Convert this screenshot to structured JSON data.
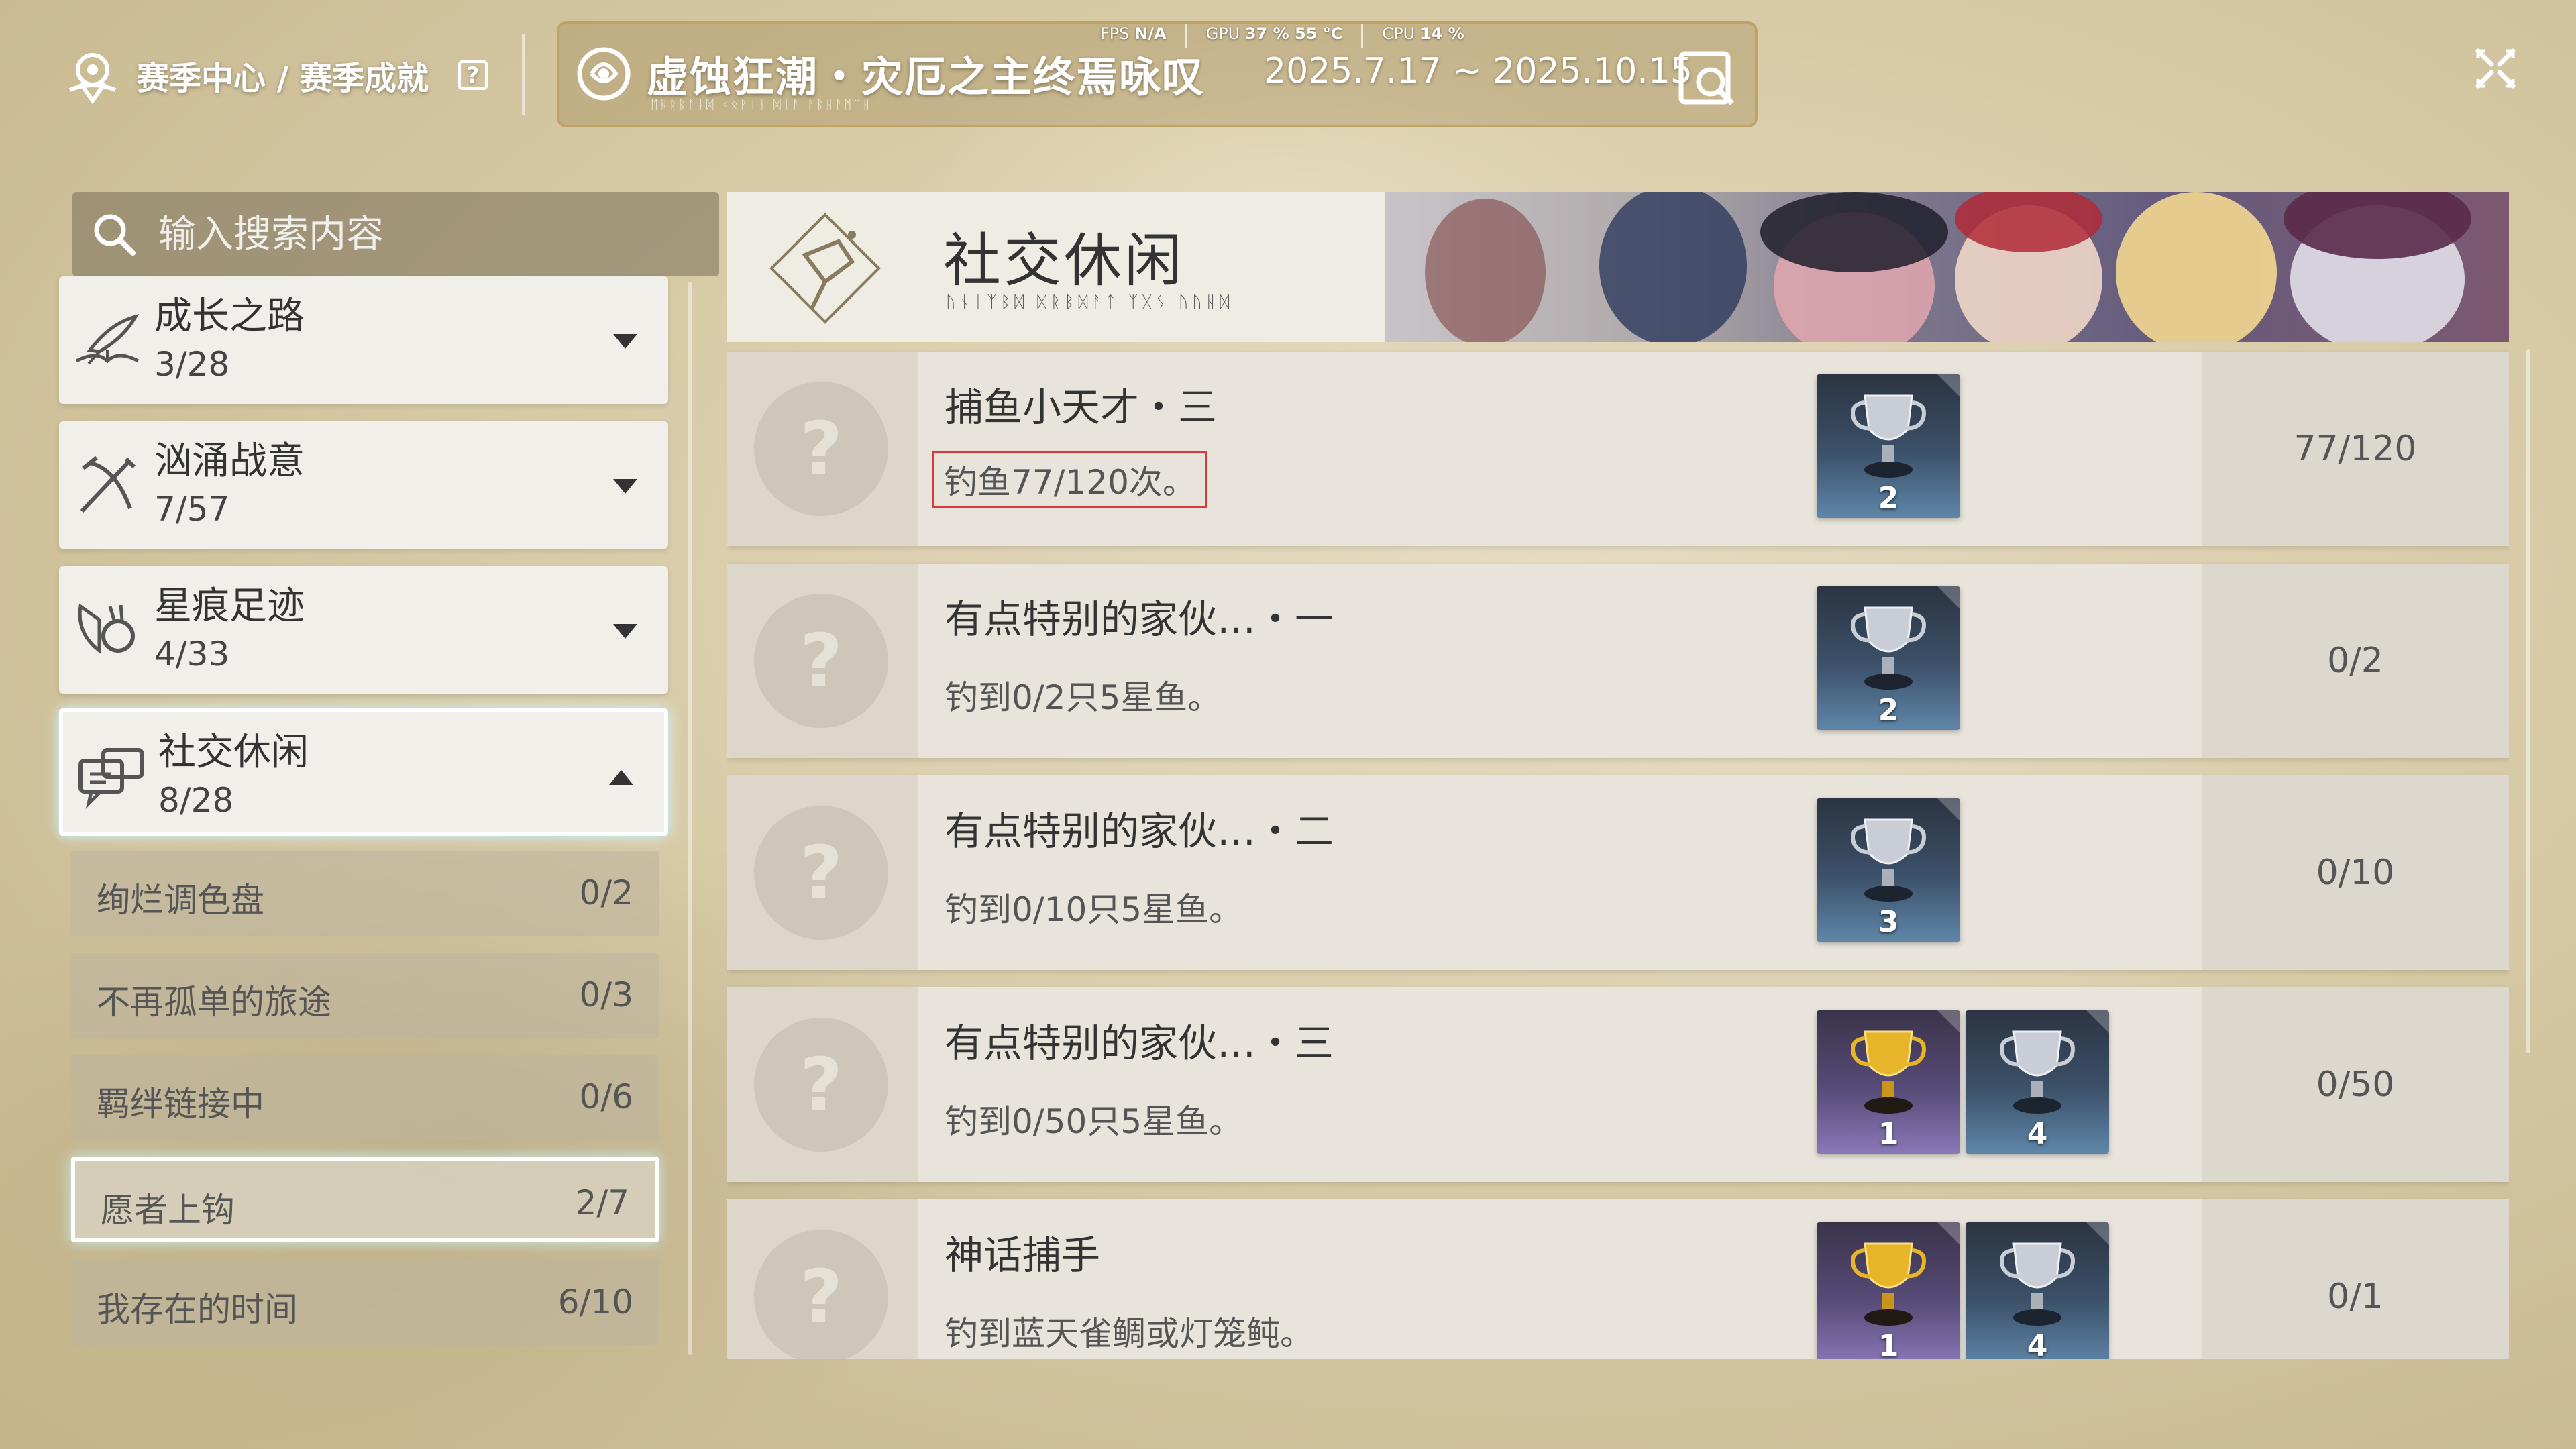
{
  "header": {
    "breadcrumb": "赛季中心 / 赛季成就",
    "help": "?",
    "season_title": "虚蚀狂潮・灾厄之主终焉咏叹",
    "season_subtitle": "ᛖᚺᚱᛒᚨᚾᛞ ᚲᛟᚹᛁᚾ ᛞᛁᚨ ᚨᛒᚺᚨᛗᛖᚺ",
    "season_dates": "2025.7.17 ~ 2025.10.15",
    "perf": {
      "fps_label": "FPS",
      "fps_value": "N/A",
      "gpu_label": "GPU",
      "gpu_value": "37 % 55 °C",
      "cpu_label": "CPU",
      "cpu_value": "14 %"
    }
  },
  "sidebar": {
    "search_placeholder": "输入搜索内容",
    "categories": [
      {
        "name": "成长之路",
        "progress": "3/28",
        "icon": "quill-book-icon"
      },
      {
        "name": "汹涌战意",
        "progress": "7/57",
        "icon": "crossed-weapons-icon"
      },
      {
        "name": "星痕足迹",
        "progress": "4/33",
        "icon": "wings-shield-icon"
      },
      {
        "name": "社交休闲",
        "progress": "8/28",
        "icon": "chat-bubbles-icon"
      }
    ],
    "subcategories": [
      {
        "label": "绚烂调色盘",
        "count": "0/2"
      },
      {
        "label": "不再孤单的旅途",
        "count": "0/3"
      },
      {
        "label": "羁绊链接中",
        "count": "0/6"
      },
      {
        "label": "愿者上钩",
        "count": "2/7"
      },
      {
        "label": "我存在的时间",
        "count": "6/10"
      }
    ]
  },
  "main": {
    "banner_title": "社交休闲",
    "banner_subtitle": "ᚢᚾᛁᛉᛒᛞ ᛞᚱᛒᛞᚨᛏ ᛉᚷᛊ ᚢᚢᚺᛞ",
    "achievements": [
      {
        "title": "捕鱼小天才・三",
        "desc": "钓鱼77/120次。",
        "progress": "77/120",
        "rewards": [
          {
            "type": "silver",
            "count": "2"
          }
        ]
      },
      {
        "title": "有点特别的家伙…・一",
        "desc": "钓到0/2只5星鱼。",
        "progress": "0/2",
        "rewards": [
          {
            "type": "silver",
            "count": "2"
          }
        ]
      },
      {
        "title": "有点特别的家伙…・二",
        "desc": "钓到0/10只5星鱼。",
        "progress": "0/10",
        "rewards": [
          {
            "type": "silver",
            "count": "3"
          }
        ]
      },
      {
        "title": "有点特别的家伙…・三",
        "desc": "钓到0/50只5星鱼。",
        "progress": "0/50",
        "rewards": [
          {
            "type": "gold",
            "count": "1"
          },
          {
            "type": "silver",
            "count": "4"
          }
        ]
      },
      {
        "title": "神话捕手",
        "desc": "钓到蓝天雀鲷或灯笼鲀。",
        "progress": "0/1",
        "rewards": [
          {
            "type": "gold",
            "count": "1"
          },
          {
            "type": "silver",
            "count": "4"
          }
        ]
      }
    ]
  },
  "colors": {
    "highlight": "#d63a3a",
    "gold_trophy_bg": "#574b78",
    "silver_trophy_bg": "#3c516a",
    "selected_glow": "#c8f0f5"
  }
}
